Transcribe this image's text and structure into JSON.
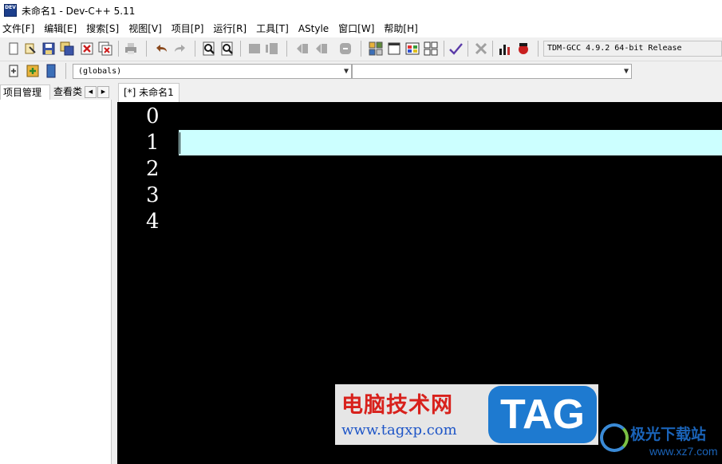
{
  "window": {
    "title": "未命名1 - Dev-C++ 5.11",
    "app_icon_label": "DEV"
  },
  "menu": [
    "文件[F]",
    "编辑[E]",
    "搜索[S]",
    "视图[V]",
    "项目[P]",
    "运行[R]",
    "工具[T]",
    "AStyle",
    "窗口[W]",
    "帮助[H]"
  ],
  "toolbar": {
    "compiler": "TDM-GCC 4.9.2 64-bit Release",
    "icons": [
      "new-file-icon",
      "open-file-icon",
      "save-icon",
      "save-all-icon",
      "close-icon",
      "close-all-icon",
      "print-icon",
      "undo-icon",
      "redo-icon",
      "find-icon",
      "replace-icon",
      "find-next-icon",
      "goto-line-icon",
      "indent-icon",
      "unindent-icon",
      "comment-icon",
      "toggle-grid-icon",
      "fullscreen-icon",
      "color-icon",
      "layout-icon",
      "check-icon",
      "delete-icon",
      "chart-icon",
      "debug-icon"
    ]
  },
  "toolbar2": {
    "scope_select": "(globals)",
    "symbol_select": ""
  },
  "left_tabs": {
    "project": "项目管理",
    "classes": "查看类"
  },
  "editor": {
    "tab_label": "[*] 未命名1",
    "line_numbers": [
      "0",
      "1",
      "2",
      "3",
      "4"
    ],
    "current_line": 1
  },
  "watermark": {
    "site_cn": "电脑技术网",
    "site_url": "www.tagxp.com",
    "tag": "TAG",
    "site2_cn": "极光下载站",
    "site2_url": "www.xz7.com"
  },
  "colors": {
    "editor_bg": "#000000",
    "current_line_bg": "#ccffff",
    "tag_blue": "#1e7ad0",
    "watermark_red": "#d8211c"
  }
}
